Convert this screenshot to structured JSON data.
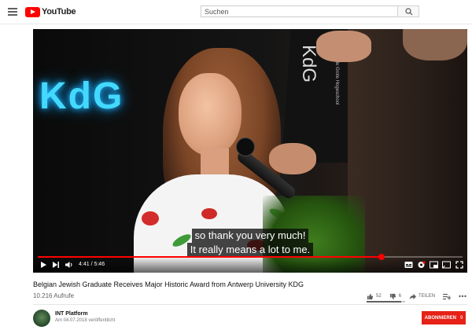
{
  "header": {
    "logo_text": "YouTube",
    "search_placeholder": "Suchen"
  },
  "player": {
    "scene_sign_left": "KdG",
    "scene_sign_right": "KdG",
    "scene_sign_right_small": "Karel de Grote Hogeschool",
    "captions": [
      "so thank you very much!",
      "It really means a lot to me."
    ],
    "time_current": "4:41",
    "time_separator": " / ",
    "time_total": "5:46",
    "progress": 0.81,
    "progress_color": "#ff0000"
  },
  "video": {
    "title": "Belgian Jewish Graduate Receives Major Historic Award from Antwerp University KDG",
    "views": "10.216 Aufrufe",
    "likes": "52",
    "dislikes": "6",
    "share_label": "TEILEN",
    "rating_ratio": 0.9
  },
  "channel": {
    "name": "INT Platform",
    "published": "Am 04.07.2018 veröffentlicht",
    "subscribe_label": "ABONNIEREN",
    "subscriber_count": "9",
    "subscribe_color": "#e62117"
  }
}
